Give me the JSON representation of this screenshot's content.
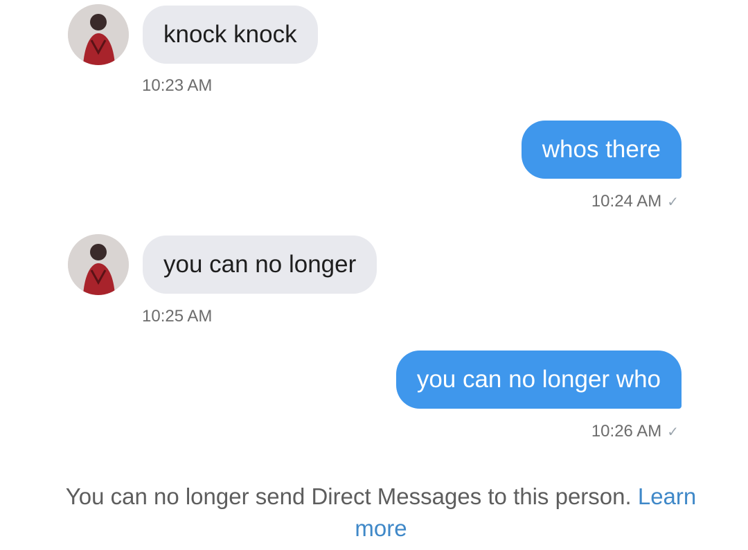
{
  "messages": [
    {
      "direction": "in",
      "text": "knock knock",
      "time": "10:23 AM"
    },
    {
      "direction": "out",
      "text": "whos there",
      "time": "10:24 AM"
    },
    {
      "direction": "in",
      "text": "you can no longer",
      "time": "10:25 AM"
    },
    {
      "direction": "out",
      "text": "you can no longer who",
      "time": "10:26 AM"
    }
  ],
  "footer": {
    "notice": "You can no longer send Direct Messages to this person.",
    "link": "Learn more"
  },
  "colors": {
    "outgoing_bubble": "#3f97ec",
    "incoming_bubble": "#e8e9ee",
    "link": "#3f88c8",
    "timestamp": "#6c6c6c"
  },
  "icons": {
    "sent_indicator": "checkmark-icon",
    "avatar": "contact-avatar"
  }
}
